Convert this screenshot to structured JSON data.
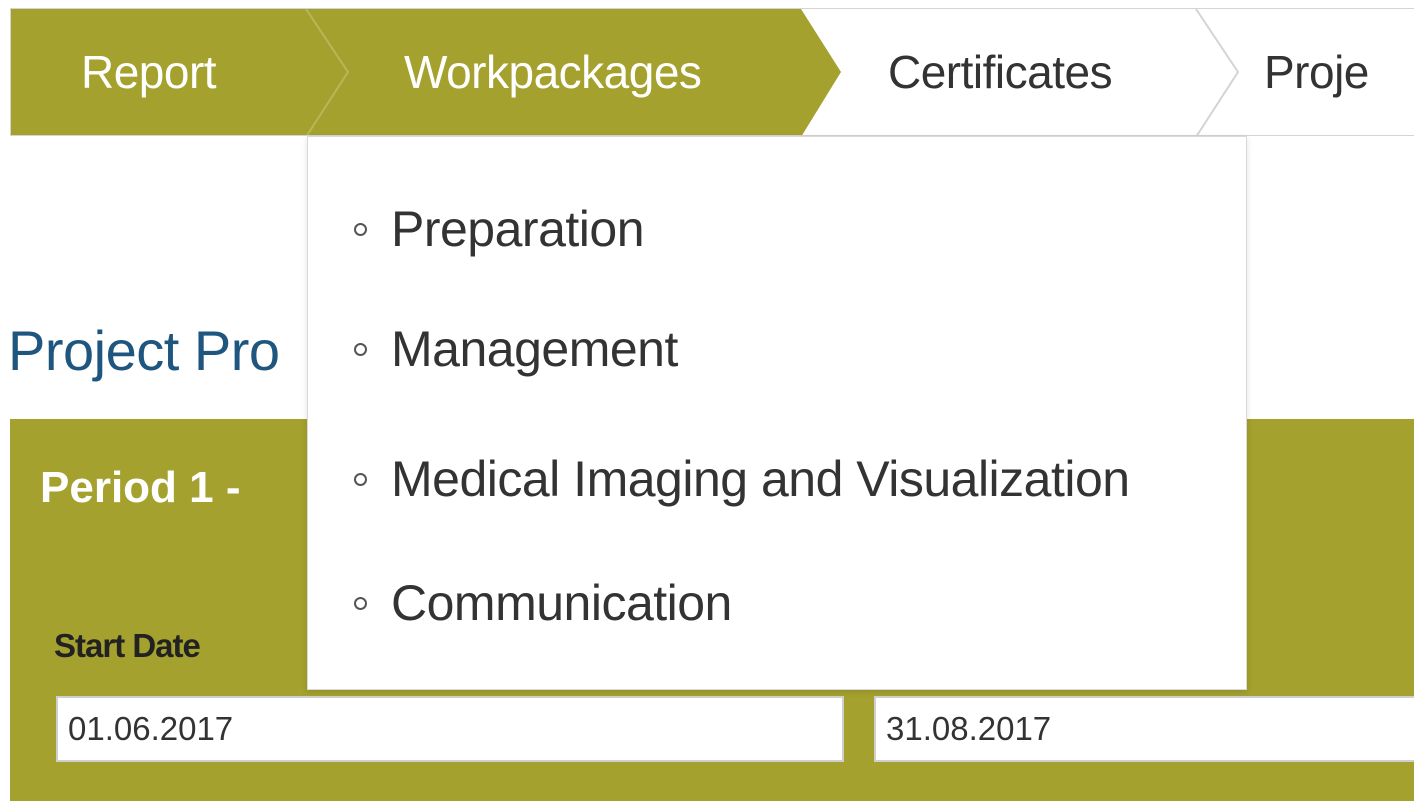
{
  "colors": {
    "accent": "#a4a12e",
    "title_blue": "#1f5680",
    "nav_border": "#d4d4d4"
  },
  "stepnav": {
    "steps": [
      {
        "label": "Report",
        "state": "completed"
      },
      {
        "label": "Workpackages",
        "state": "active"
      },
      {
        "label": "Certificates",
        "state": "upcoming"
      },
      {
        "label": "Proje",
        "state": "upcoming"
      }
    ]
  },
  "dropdown": {
    "bullet_icon": "hollow-circle-icon",
    "items": [
      {
        "label": "Preparation"
      },
      {
        "label": "Management"
      },
      {
        "label": "Medical Imaging and Visualization"
      },
      {
        "label": "Communication"
      }
    ]
  },
  "page": {
    "title": "Project Pro"
  },
  "period": {
    "title": "Period 1 -",
    "start_label": "Start Date",
    "start_value": "01.06.2017",
    "end_value": "31.08.2017"
  }
}
